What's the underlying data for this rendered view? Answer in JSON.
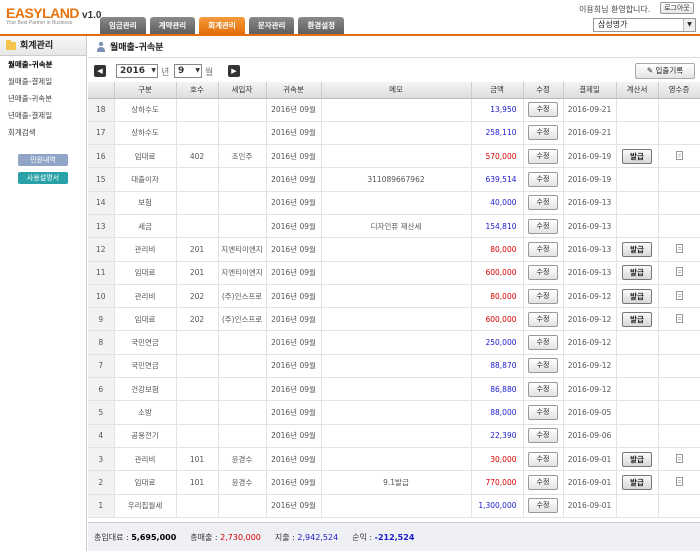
{
  "app": {
    "brand": "EASYLAND",
    "version": "v1.0",
    "tagline": "Your Best Partner in Business",
    "welcome": "이용희님 환영합니다.",
    "logout_label": "로그아웃",
    "company": "삼성명가"
  },
  "tabs": [
    {
      "label": "임금관리",
      "active": false
    },
    {
      "label": "계약관리",
      "active": false
    },
    {
      "label": "회계관리",
      "active": true
    },
    {
      "label": "문자관리",
      "active": false
    },
    {
      "label": "환경설정",
      "active": false
    }
  ],
  "sidebar": {
    "title": "회계관리",
    "items": [
      {
        "label": "월매출-귀속분",
        "active": true
      },
      {
        "label": "월매출-결제일",
        "active": false
      },
      {
        "label": "년매출-귀속분",
        "active": false
      },
      {
        "label": "년매출-결제일",
        "active": false
      },
      {
        "label": "회계검색",
        "active": false
      }
    ],
    "button_complaints": "민원내역",
    "button_manual": "사용설명서"
  },
  "page": {
    "title": "월매출-귀속분",
    "year": "2016",
    "year_unit": "년",
    "month": "9",
    "month_unit": "월",
    "ledger_button": "입출기록"
  },
  "table": {
    "headers": [
      "",
      "구분",
      "호수",
      "세입자",
      "귀속분",
      "메모",
      "금액",
      "수정",
      "결제일",
      "계산서",
      "영수증"
    ],
    "edit_label": "수정",
    "issue_label": "발급",
    "rows": [
      {
        "no": "18",
        "cat": "상하수도",
        "unit": "",
        "tenant": "",
        "period": "2016년 09월",
        "memo": "",
        "amount": "13,950",
        "color": "blue",
        "date": "2016-09-21",
        "invoice": false,
        "receipt": false
      },
      {
        "no": "17",
        "cat": "상하수도",
        "unit": "",
        "tenant": "",
        "period": "2016년 09월",
        "memo": "",
        "amount": "258,110",
        "color": "blue",
        "date": "2016-09-21",
        "invoice": false,
        "receipt": false
      },
      {
        "no": "16",
        "cat": "임대료",
        "unit": "402",
        "tenant": "조인주",
        "period": "2016년 09월",
        "memo": "",
        "amount": "570,000",
        "color": "red",
        "date": "2016-09-19",
        "invoice": true,
        "receipt": true
      },
      {
        "no": "15",
        "cat": "대출이자",
        "unit": "",
        "tenant": "",
        "period": "2016년 09월",
        "memo": "311089667962",
        "amount": "639,514",
        "color": "blue",
        "date": "2016-09-19",
        "invoice": false,
        "receipt": false
      },
      {
        "no": "14",
        "cat": "보험",
        "unit": "",
        "tenant": "",
        "period": "2016년 09월",
        "memo": "",
        "amount": "40,000",
        "color": "blue",
        "date": "2016-09-13",
        "invoice": false,
        "receipt": false
      },
      {
        "no": "13",
        "cat": "세금",
        "unit": "",
        "tenant": "",
        "period": "2016년 09월",
        "memo": "디자인퓨 재산세",
        "amount": "154,810",
        "color": "blue",
        "date": "2016-09-13",
        "invoice": false,
        "receipt": false
      },
      {
        "no": "12",
        "cat": "관리비",
        "unit": "201",
        "tenant": "지엔티이엔지",
        "period": "2016년 09월",
        "memo": "",
        "amount": "80,000",
        "color": "red",
        "date": "2016-09-13",
        "invoice": true,
        "receipt": true
      },
      {
        "no": "11",
        "cat": "임대료",
        "unit": "201",
        "tenant": "지엔티이엔지",
        "period": "2016년 09월",
        "memo": "",
        "amount": "600,000",
        "color": "red",
        "date": "2016-09-13",
        "invoice": true,
        "receipt": true
      },
      {
        "no": "10",
        "cat": "관리비",
        "unit": "202",
        "tenant": "(주)인스프로",
        "period": "2016년 09월",
        "memo": "",
        "amount": "80,000",
        "color": "red",
        "date": "2016-09-12",
        "invoice": true,
        "receipt": true
      },
      {
        "no": "9",
        "cat": "임대료",
        "unit": "202",
        "tenant": "(주)인스프로",
        "period": "2016년 09월",
        "memo": "",
        "amount": "600,000",
        "color": "red",
        "date": "2016-09-12",
        "invoice": true,
        "receipt": true
      },
      {
        "no": "8",
        "cat": "국민연금",
        "unit": "",
        "tenant": "",
        "period": "2016년 09월",
        "memo": "",
        "amount": "250,000",
        "color": "blue",
        "date": "2016-09-12",
        "invoice": false,
        "receipt": false
      },
      {
        "no": "7",
        "cat": "국민연금",
        "unit": "",
        "tenant": "",
        "period": "2016년 09월",
        "memo": "",
        "amount": "88,870",
        "color": "blue",
        "date": "2016-09-12",
        "invoice": false,
        "receipt": false
      },
      {
        "no": "6",
        "cat": "건강보험",
        "unit": "",
        "tenant": "",
        "period": "2016년 09월",
        "memo": "",
        "amount": "86,880",
        "color": "blue",
        "date": "2016-09-12",
        "invoice": false,
        "receipt": false
      },
      {
        "no": "5",
        "cat": "소방",
        "unit": "",
        "tenant": "",
        "period": "2016년 09월",
        "memo": "",
        "amount": "88,000",
        "color": "blue",
        "date": "2016-09-05",
        "invoice": false,
        "receipt": false
      },
      {
        "no": "4",
        "cat": "공용전기",
        "unit": "",
        "tenant": "",
        "period": "2016년 09월",
        "memo": "",
        "amount": "22,390",
        "color": "blue",
        "date": "2016-09-06",
        "invoice": false,
        "receipt": false
      },
      {
        "no": "3",
        "cat": "관리비",
        "unit": "101",
        "tenant": "윤경수",
        "period": "2016년 09월",
        "memo": "",
        "amount": "30,000",
        "color": "red",
        "date": "2016-09-01",
        "invoice": true,
        "receipt": true
      },
      {
        "no": "2",
        "cat": "임대료",
        "unit": "101",
        "tenant": "윤경수",
        "period": "2016년 09월",
        "memo": "9.1발급",
        "amount": "770,000",
        "color": "red",
        "date": "2016-09-01",
        "invoice": true,
        "receipt": true
      },
      {
        "no": "1",
        "cat": "우리집월세",
        "unit": "",
        "tenant": "",
        "period": "2016년 09월",
        "memo": "",
        "amount": "1,300,000",
        "color": "blue",
        "date": "2016-09-01",
        "invoice": false,
        "receipt": false
      }
    ]
  },
  "summary": {
    "deposit_label": "총입대료 :",
    "deposit_value": "5,695,000",
    "sales_label": "총매출 :",
    "sales_value": "2,730,000",
    "expense_label": "지출 :",
    "expense_value": "2,942,524",
    "profit_label": "순익 :",
    "profit_value": "-212,524"
  },
  "colors": {
    "accent": "#e36e0a",
    "amount_blue": "#1a1acc",
    "amount_red": "#d40000"
  }
}
